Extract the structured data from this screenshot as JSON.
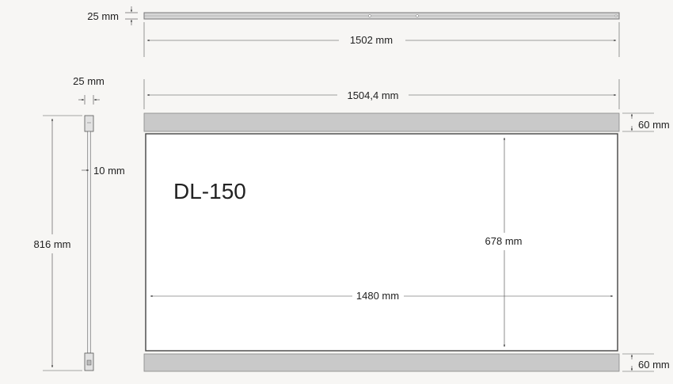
{
  "dimensions": {
    "rail_height": "25 mm",
    "rail_length": "1502 mm",
    "profile_width": "25 mm",
    "profile_gap": "10 mm",
    "total_height": "816 mm",
    "frame_width": "1504,4 mm",
    "bar_height_top": "60 mm",
    "bar_height_bottom": "60 mm",
    "panel_height": "678 mm",
    "panel_width": "1480 mm"
  },
  "model": "DL-150",
  "colors": {
    "background": "#f7f6f4",
    "panel_fill": "#ffffff",
    "bar_fill": "#c9c9c9",
    "line": "#333333"
  }
}
